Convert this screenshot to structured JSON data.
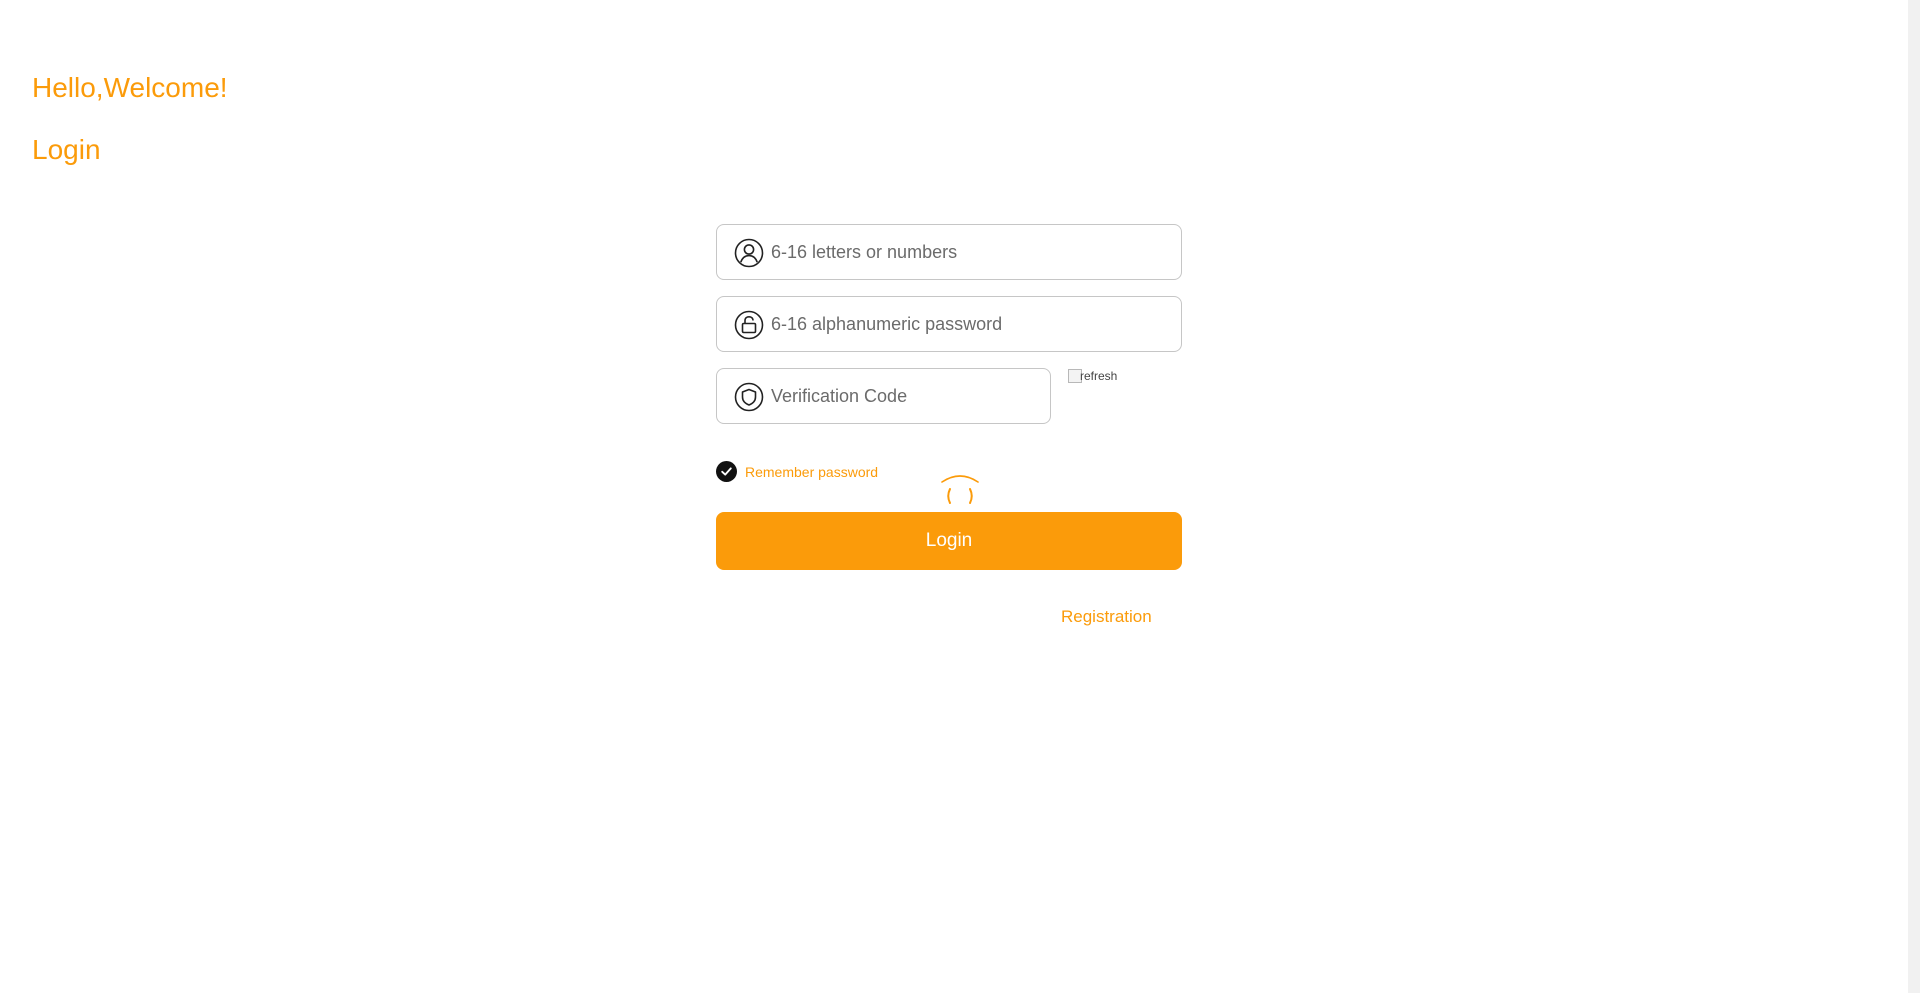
{
  "header": {
    "greeting": "Hello,Welcome!",
    "title": "Login"
  },
  "form": {
    "username": {
      "placeholder": "6-16 letters or numbers",
      "value": "",
      "icon": "user-icon"
    },
    "password": {
      "placeholder": "6-16 alphanumeric password",
      "value": "",
      "icon": "lock-icon"
    },
    "verification_code": {
      "placeholder": "Verification Code",
      "value": "",
      "icon": "shield-icon"
    },
    "captcha_image_alt": "refresh",
    "remember_password": {
      "label": "Remember password",
      "checked": true
    },
    "login_button_label": "Login",
    "registration_link_label": "Registration"
  },
  "colors": {
    "accent": "#fb9b0a",
    "border": "#c6c6c6",
    "background": "#ffffff"
  }
}
